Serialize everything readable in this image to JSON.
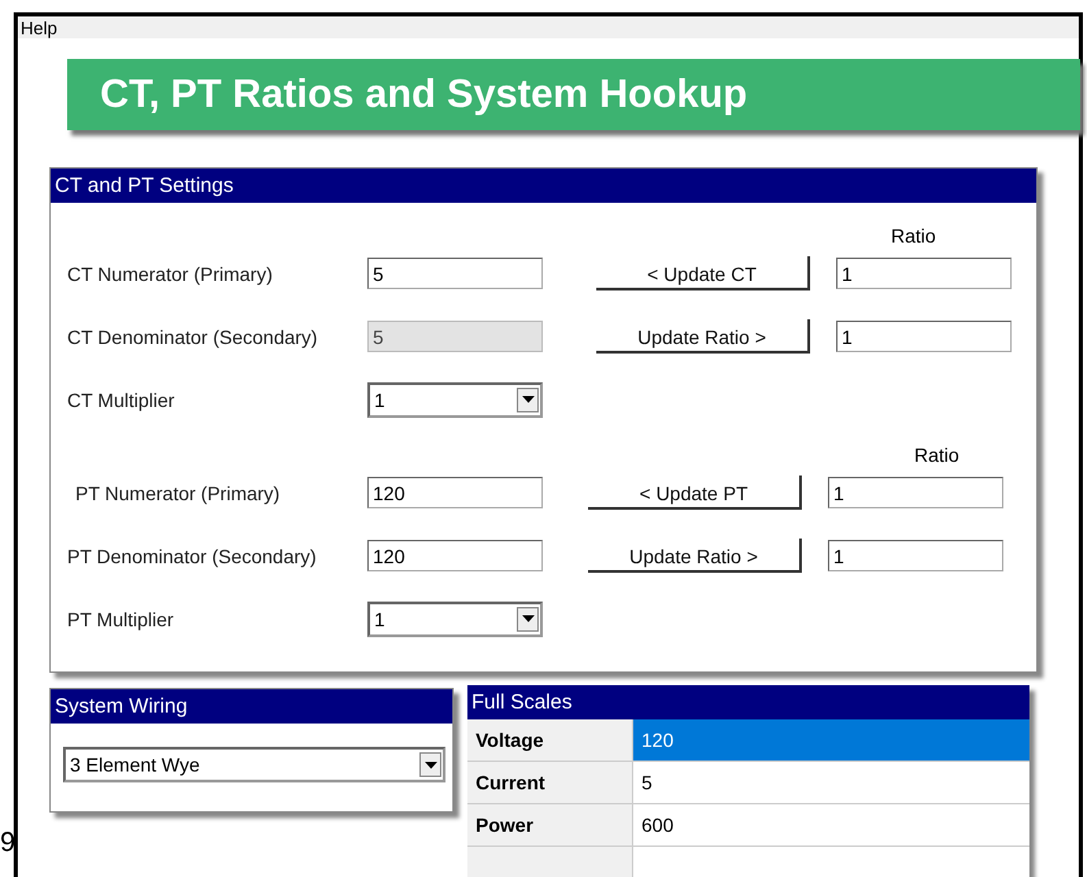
{
  "menu": [
    "Help"
  ],
  "banner": {
    "title": "CT, PT Ratios and System Hookup"
  },
  "settings": {
    "title": "CT and PT Settings",
    "sections": [
      {
        "ratio_heading": "Ratio",
        "rows": [
          {
            "label": "CT Numerator (Primary)",
            "kind": "input",
            "value": "5",
            "disabled": false,
            "button": "< Update CT",
            "ratio": "1"
          },
          {
            "label": "CT Denominator (Secondary)",
            "kind": "input",
            "value": "5",
            "disabled": true,
            "button": "Update Ratio >",
            "ratio": "1"
          },
          {
            "label": "CT Multiplier",
            "kind": "select",
            "value": "1"
          }
        ]
      },
      {
        "ratio_heading": "Ratio",
        "rows": [
          {
            "label": "PT Numerator (Primary)",
            "kind": "input",
            "value": "120",
            "disabled": false,
            "button": "< Update PT",
            "ratio": "1"
          },
          {
            "label": "PT Denominator (Secondary)",
            "kind": "input",
            "value": "120",
            "disabled": false,
            "button": "Update Ratio >",
            "ratio": "1"
          },
          {
            "label": "PT Multiplier",
            "kind": "select",
            "value": "1"
          }
        ]
      }
    ]
  },
  "system_wiring": {
    "title": "System Wiring",
    "value": "3 Element Wye"
  },
  "full_scales": {
    "title": "Full Scales",
    "rows": [
      {
        "label": "Voltage",
        "value": "120",
        "selected": true
      },
      {
        "label": "Current",
        "value": "5",
        "selected": false
      },
      {
        "label": "Power",
        "value": "600",
        "selected": false
      }
    ]
  },
  "edge_text": "9"
}
